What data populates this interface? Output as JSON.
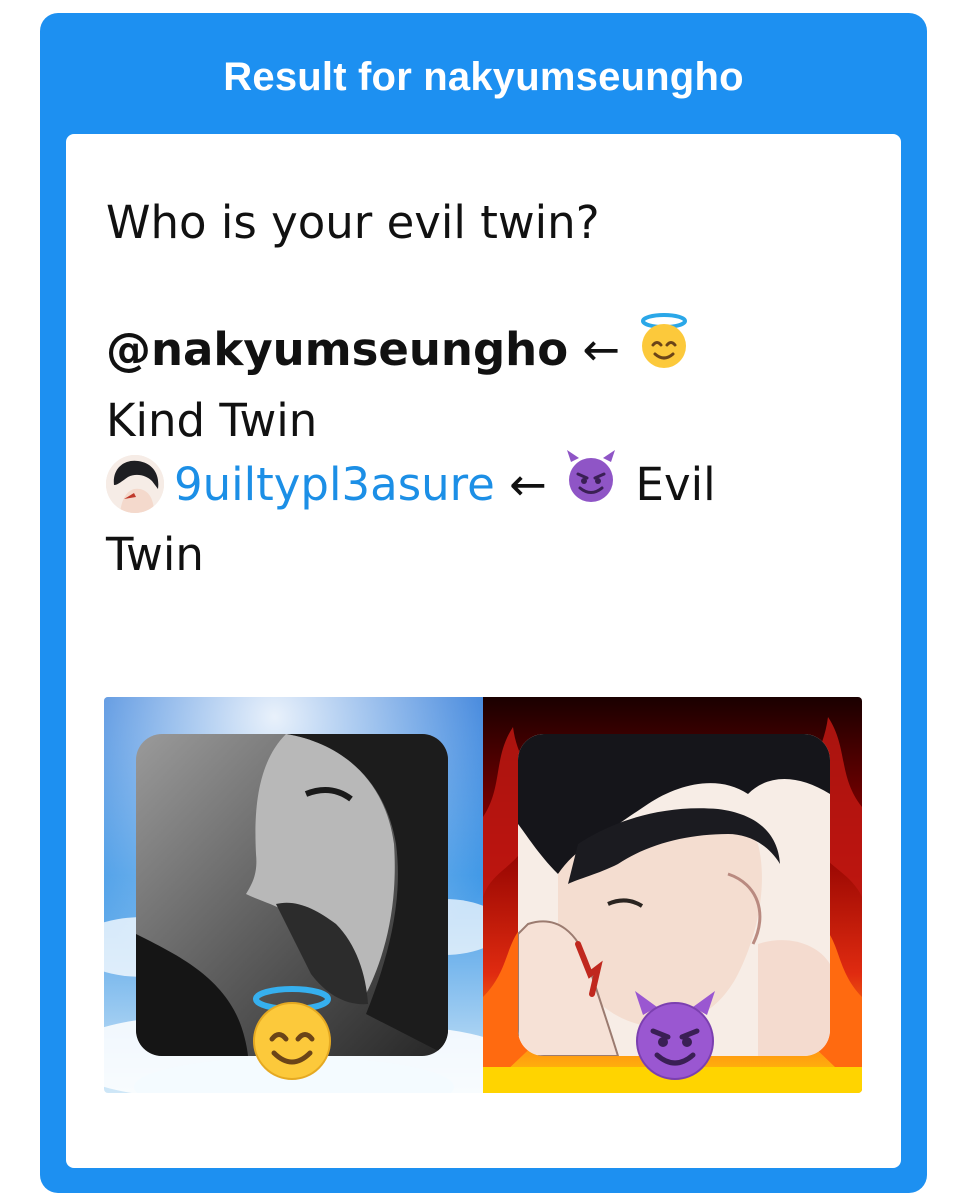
{
  "header": {
    "title": "Result for nakyumseungho"
  },
  "tweet": {
    "question": "Who is your evil twin?",
    "kind_handle": "@nakyumseungho",
    "arrow": "←",
    "kind_label_line1": "",
    "kind_label_line2": "Kind Twin",
    "evil_handle": "9uiltypl3asure",
    "evil_label_line1": "Evil",
    "evil_label_line2": "Twin",
    "mention_color": "#1c8fe6"
  },
  "images": {
    "left_panel": {
      "icon": "smiling-face-with-halo-icon",
      "background": "sky-with-clouds"
    },
    "right_panel": {
      "icon": "smiling-face-with-horns-icon",
      "background": "flames"
    }
  },
  "colors": {
    "brand_blue": "#1d90f1",
    "card_bg": "#ffffff",
    "text": "#111111"
  }
}
